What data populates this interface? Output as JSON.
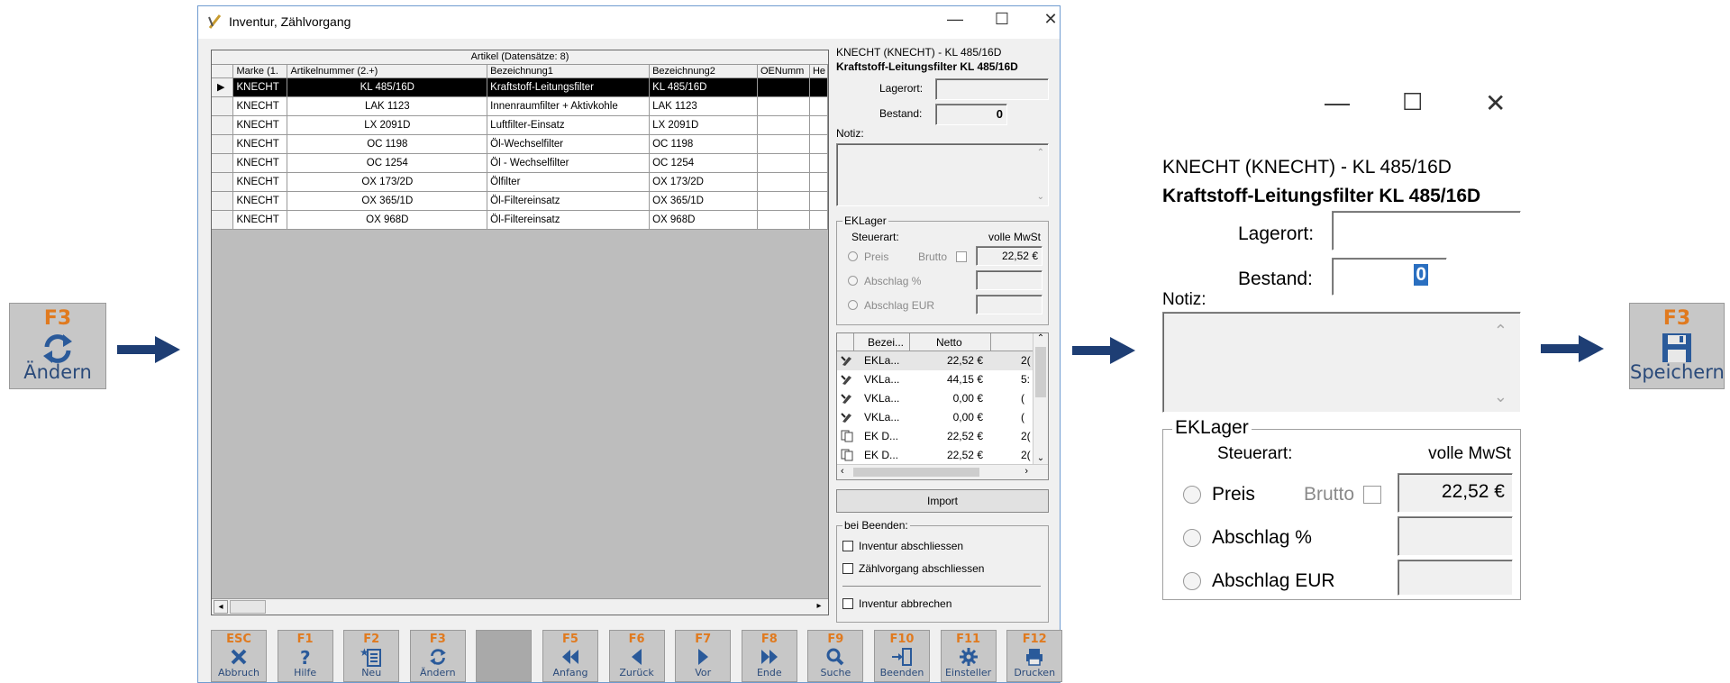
{
  "left_button": {
    "key": "F3",
    "label": "Ändern",
    "icon": "refresh-icon"
  },
  "right_button": {
    "key": "F3",
    "label": "Speichern",
    "icon": "save-icon"
  },
  "window": {
    "title": "Inventur, Zählvorgang",
    "controls": {
      "minimize": "—",
      "maximize": "☐",
      "close": "✕"
    }
  },
  "grid": {
    "caption": "Artikel (Datensätze: 8)",
    "columns": [
      "Marke (1.",
      "Artikelnummer (2.+)",
      "Bezeichnung1",
      "Bezeichnung2",
      "OENumm",
      "He"
    ],
    "rows": [
      [
        "KNECHT",
        "KL 485/16D",
        "Kraftstoff-Leitungsfilter",
        "KL 485/16D",
        "",
        ""
      ],
      [
        "KNECHT",
        "LAK 1123",
        "Innenraumfilter + Aktivkohle",
        "LAK 1123",
        "",
        ""
      ],
      [
        "KNECHT",
        "LX 2091D",
        "Luftfilter-Einsatz",
        "LX 2091D",
        "",
        ""
      ],
      [
        "KNECHT",
        "OC 1198",
        "Öl-Wechselfilter",
        "OC 1198",
        "",
        ""
      ],
      [
        "KNECHT",
        "OC 1254",
        "Öl - Wechselfilter",
        "OC 1254",
        "",
        ""
      ],
      [
        "KNECHT",
        "OX 173/2D",
        "Ölfilter",
        "OX 173/2D",
        "",
        ""
      ],
      [
        "KNECHT",
        "OX 365/1D",
        "Öl-Filtereinsatz",
        "OX 365/1D",
        "",
        ""
      ],
      [
        "KNECHT",
        "OX 968D",
        "Öl-Filtereinsatz",
        "OX 968D",
        "",
        ""
      ]
    ]
  },
  "detail": {
    "header": "KNECHT (KNECHT) - KL 485/16D",
    "name": "Kraftstoff-Leitungsfilter KL 485/16D",
    "lagerort_label": "Lagerort:",
    "lagerort_value": "",
    "bestand_label": "Bestand:",
    "bestand_value": "0",
    "notiz_label": "Notiz:",
    "notiz_value": "",
    "ek_legend": "EKLager",
    "steuerart_label": "Steuerart:",
    "steuerart_value": "volle MwSt",
    "preis_label": "Preis",
    "brutto_label": "Brutto",
    "preis_value": "22,52 €",
    "abschlag_pct_label": "Abschlag %",
    "abschlag_eur_label": "Abschlag EUR"
  },
  "price_list": {
    "columns": [
      "Bezei...",
      "Netto"
    ],
    "rows": [
      {
        "icon": "brush-icon",
        "name": "EKLa...",
        "netto": "22,52 €",
        "extra": "2("
      },
      {
        "icon": "brush-icon",
        "name": "VKLa...",
        "netto": "44,15 €",
        "extra": "5:"
      },
      {
        "icon": "brush-icon",
        "name": "VKLa...",
        "netto": "0,00 €",
        "extra": "("
      },
      {
        "icon": "brush-icon",
        "name": "VKLa...",
        "netto": "0,00 €",
        "extra": "("
      },
      {
        "icon": "copy-icon",
        "name": "EK D...",
        "netto": "22,52 €",
        "extra": "2("
      },
      {
        "icon": "copy-icon",
        "name": "EK D...",
        "netto": "22,52 €",
        "extra": "2("
      }
    ]
  },
  "import_button": "Import",
  "on_finish": {
    "legend": "bei Beenden:",
    "opt1": "Inventur abschliessen",
    "opt2": "Zählvorgang abschliessen",
    "opt3": "Inventur abbrechen"
  },
  "fkeys": [
    {
      "key": "ESC",
      "label": "Abbruch",
      "icon": "close-icon"
    },
    {
      "key": "F1",
      "label": "Hilfe",
      "icon": "help-icon"
    },
    {
      "key": "F2",
      "label": "Neu",
      "icon": "new-icon"
    },
    {
      "key": "F3",
      "label": "Ändern",
      "icon": "refresh-icon"
    },
    {
      "key": "",
      "label": "",
      "icon": ""
    },
    {
      "key": "F5",
      "label": "Anfang",
      "icon": "first-icon"
    },
    {
      "key": "F6",
      "label": "Zurück",
      "icon": "prev-icon"
    },
    {
      "key": "F7",
      "label": "Vor",
      "icon": "next-icon"
    },
    {
      "key": "F8",
      "label": "Ende",
      "icon": "last-icon"
    },
    {
      "key": "F9",
      "label": "Suche",
      "icon": "search-icon"
    },
    {
      "key": "F10",
      "label": "Beenden",
      "icon": "exit-icon"
    },
    {
      "key": "F11",
      "label": "Einsteller",
      "icon": "gear-icon"
    },
    {
      "key": "F12",
      "label": "Drucken",
      "icon": "print-icon"
    }
  ],
  "zoom": {
    "header": "KNECHT (KNECHT) - KL 485/16D",
    "name": "Kraftstoff-Leitungsfilter KL 485/16D",
    "lagerort_label": "Lagerort:",
    "bestand_label": "Bestand:",
    "bestand_value": "0",
    "notiz_label": "Notiz:",
    "ek_legend": "EKLager",
    "steuerart_label": "Steuerart:",
    "steuerart_value": "volle MwSt",
    "preis_label": "Preis",
    "brutto_label": "Brutto",
    "preis_value": "22,52 €",
    "abschlag_pct_label": "Abschlag %",
    "abschlag_eur_label": "Abschlag EUR"
  }
}
